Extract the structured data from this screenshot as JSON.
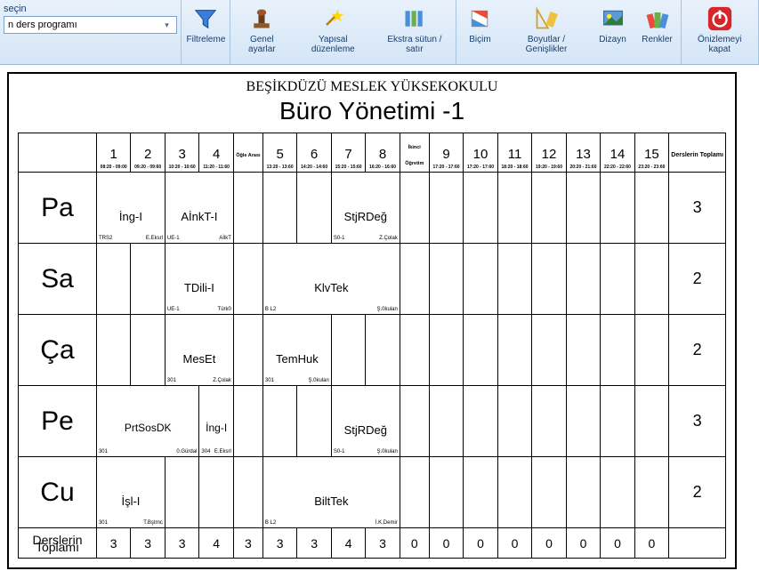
{
  "leftPanel": {
    "label": "seçin",
    "dropdownValue": "n ders programı"
  },
  "toolbar": {
    "filter": "Filtreleme",
    "general": "Genel ayarlar",
    "structural": "Yapısal düzenleme",
    "extra": "Ekstra sütun / satır",
    "format": "Biçim",
    "sizes": "Boyutlar / Genişlikler",
    "design": "Dizayn",
    "colors": "Renkler",
    "closePreview": "Önizlemeyi kapat"
  },
  "page": {
    "school": "BEŞİKDÜZÜ MESLEK YÜKSEKOKULU",
    "dept": "Büro Yönetimi -1"
  },
  "periods": [
    {
      "n": "1",
      "t": "08:20 - 09:00"
    },
    {
      "n": "2",
      "t": "09:20 - 09:60"
    },
    {
      "n": "3",
      "t": "10:20 - 10:60"
    },
    {
      "n": "4",
      "t": "11:20 - 11:60"
    }
  ],
  "breakLabel": "Öğle Arası",
  "periods2": [
    {
      "n": "5",
      "t": "13:20 - 13:60"
    },
    {
      "n": "6",
      "t": "14:20 - 14:60"
    },
    {
      "n": "7",
      "t": "15:20 - 15:60"
    },
    {
      "n": "8",
      "t": "16:20 - 16:60"
    }
  ],
  "breakLabel2": "İkinci Öğretim",
  "periods3": [
    {
      "n": "9",
      "t": "17:20 - 17:60"
    },
    {
      "n": "10",
      "t": "17:20 - 17:60"
    },
    {
      "n": "11",
      "t": "18:20 - 18:60"
    },
    {
      "n": "12",
      "t": "19:20 - 19:60"
    },
    {
      "n": "13",
      "t": "20:20 - 21:60"
    },
    {
      "n": "14",
      "t": "22:20 - 22:60"
    },
    {
      "n": "15",
      "t": "23:20 - 23:60"
    }
  ],
  "totalHeader": "Derslerin Toplamı",
  "days": {
    "pa": {
      "label": "Pa",
      "total": "3"
    },
    "sa": {
      "label": "Sa",
      "total": "2"
    },
    "ca": {
      "label": "Ça",
      "total": "2"
    },
    "pe": {
      "label": "Pe",
      "total": "3"
    },
    "cu": {
      "label": "Cu",
      "total": "2"
    }
  },
  "lessons": {
    "pa_ing": {
      "name": "İng-I",
      "room": "TRS2",
      "teacher": "E.Eksrl"
    },
    "pa_aink": {
      "name": "AİnkT-I",
      "room": "UE-1",
      "teacher": "AİlkT"
    },
    "pa_stj": {
      "name": "StjRDeğ",
      "room": "S0-1",
      "teacher": "Z.Çolak"
    },
    "sa_tdil": {
      "name": "TDili-I",
      "room": "UE-1",
      "teacher": "Türk0"
    },
    "sa_klv": {
      "name": "KlvTek",
      "room": "B L2",
      "teacher": "Ş.0kulan"
    },
    "ca_mes": {
      "name": "MesEt",
      "room": "301",
      "teacher": "Z.Çolak"
    },
    "ca_tem": {
      "name": "TemHuk",
      "room": "301",
      "teacher": "Ş.0kulan"
    },
    "pe_prt": {
      "name": "PrtSosDK",
      "room": "301",
      "teacher": "0.Gürdal"
    },
    "pe_ing": {
      "name": "İng-I",
      "room": "304",
      "teacher": "E.Eksrl"
    },
    "pe_stj": {
      "name": "StjRDeğ",
      "room": "S0-1",
      "teacher": "Ş.0kulan"
    },
    "cu_isl": {
      "name": "İşl-I",
      "room": "301",
      "teacher": "T.Bştrnc"
    },
    "cu_bilt": {
      "name": "BiltTek",
      "room": "B L2",
      "teacher": "İ.K.Demir"
    }
  },
  "footerLabel": "Derslerin Toplamı",
  "footerTotals": [
    "3",
    "3",
    "3",
    "4",
    "3",
    "3",
    "3",
    "4",
    "3",
    "0",
    "0",
    "0",
    "0",
    "0",
    "0",
    "0",
    "0"
  ]
}
